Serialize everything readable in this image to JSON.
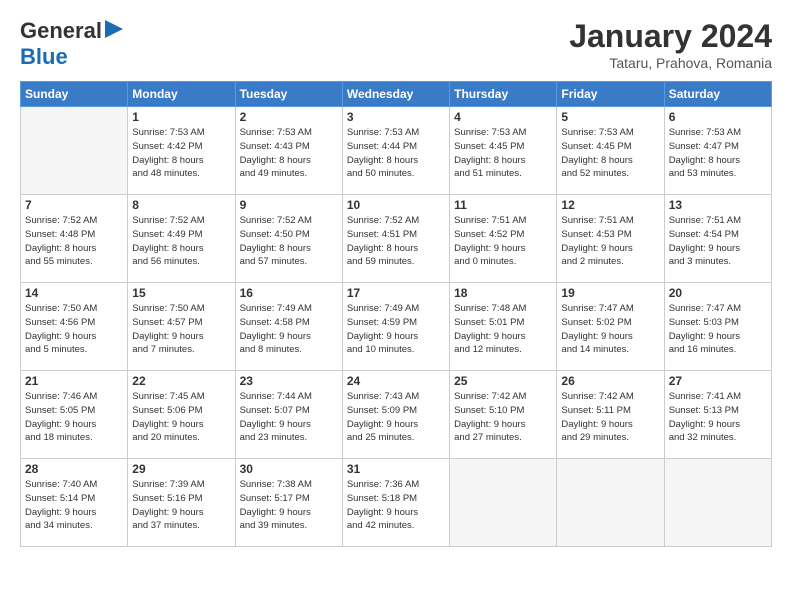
{
  "header": {
    "logo_line1": "General",
    "logo_line2": "Blue",
    "month": "January 2024",
    "location": "Tataru, Prahova, Romania"
  },
  "weekdays": [
    "Sunday",
    "Monday",
    "Tuesday",
    "Wednesday",
    "Thursday",
    "Friday",
    "Saturday"
  ],
  "weeks": [
    [
      {
        "day": "",
        "info": ""
      },
      {
        "day": "1",
        "info": "Sunrise: 7:53 AM\nSunset: 4:42 PM\nDaylight: 8 hours\nand 48 minutes."
      },
      {
        "day": "2",
        "info": "Sunrise: 7:53 AM\nSunset: 4:43 PM\nDaylight: 8 hours\nand 49 minutes."
      },
      {
        "day": "3",
        "info": "Sunrise: 7:53 AM\nSunset: 4:44 PM\nDaylight: 8 hours\nand 50 minutes."
      },
      {
        "day": "4",
        "info": "Sunrise: 7:53 AM\nSunset: 4:45 PM\nDaylight: 8 hours\nand 51 minutes."
      },
      {
        "day": "5",
        "info": "Sunrise: 7:53 AM\nSunset: 4:45 PM\nDaylight: 8 hours\nand 52 minutes."
      },
      {
        "day": "6",
        "info": "Sunrise: 7:53 AM\nSunset: 4:47 PM\nDaylight: 8 hours\nand 53 minutes."
      }
    ],
    [
      {
        "day": "7",
        "info": "Sunrise: 7:52 AM\nSunset: 4:48 PM\nDaylight: 8 hours\nand 55 minutes."
      },
      {
        "day": "8",
        "info": "Sunrise: 7:52 AM\nSunset: 4:49 PM\nDaylight: 8 hours\nand 56 minutes."
      },
      {
        "day": "9",
        "info": "Sunrise: 7:52 AM\nSunset: 4:50 PM\nDaylight: 8 hours\nand 57 minutes."
      },
      {
        "day": "10",
        "info": "Sunrise: 7:52 AM\nSunset: 4:51 PM\nDaylight: 8 hours\nand 59 minutes."
      },
      {
        "day": "11",
        "info": "Sunrise: 7:51 AM\nSunset: 4:52 PM\nDaylight: 9 hours\nand 0 minutes."
      },
      {
        "day": "12",
        "info": "Sunrise: 7:51 AM\nSunset: 4:53 PM\nDaylight: 9 hours\nand 2 minutes."
      },
      {
        "day": "13",
        "info": "Sunrise: 7:51 AM\nSunset: 4:54 PM\nDaylight: 9 hours\nand 3 minutes."
      }
    ],
    [
      {
        "day": "14",
        "info": "Sunrise: 7:50 AM\nSunset: 4:56 PM\nDaylight: 9 hours\nand 5 minutes."
      },
      {
        "day": "15",
        "info": "Sunrise: 7:50 AM\nSunset: 4:57 PM\nDaylight: 9 hours\nand 7 minutes."
      },
      {
        "day": "16",
        "info": "Sunrise: 7:49 AM\nSunset: 4:58 PM\nDaylight: 9 hours\nand 8 minutes."
      },
      {
        "day": "17",
        "info": "Sunrise: 7:49 AM\nSunset: 4:59 PM\nDaylight: 9 hours\nand 10 minutes."
      },
      {
        "day": "18",
        "info": "Sunrise: 7:48 AM\nSunset: 5:01 PM\nDaylight: 9 hours\nand 12 minutes."
      },
      {
        "day": "19",
        "info": "Sunrise: 7:47 AM\nSunset: 5:02 PM\nDaylight: 9 hours\nand 14 minutes."
      },
      {
        "day": "20",
        "info": "Sunrise: 7:47 AM\nSunset: 5:03 PM\nDaylight: 9 hours\nand 16 minutes."
      }
    ],
    [
      {
        "day": "21",
        "info": "Sunrise: 7:46 AM\nSunset: 5:05 PM\nDaylight: 9 hours\nand 18 minutes."
      },
      {
        "day": "22",
        "info": "Sunrise: 7:45 AM\nSunset: 5:06 PM\nDaylight: 9 hours\nand 20 minutes."
      },
      {
        "day": "23",
        "info": "Sunrise: 7:44 AM\nSunset: 5:07 PM\nDaylight: 9 hours\nand 23 minutes."
      },
      {
        "day": "24",
        "info": "Sunrise: 7:43 AM\nSunset: 5:09 PM\nDaylight: 9 hours\nand 25 minutes."
      },
      {
        "day": "25",
        "info": "Sunrise: 7:42 AM\nSunset: 5:10 PM\nDaylight: 9 hours\nand 27 minutes."
      },
      {
        "day": "26",
        "info": "Sunrise: 7:42 AM\nSunset: 5:11 PM\nDaylight: 9 hours\nand 29 minutes."
      },
      {
        "day": "27",
        "info": "Sunrise: 7:41 AM\nSunset: 5:13 PM\nDaylight: 9 hours\nand 32 minutes."
      }
    ],
    [
      {
        "day": "28",
        "info": "Sunrise: 7:40 AM\nSunset: 5:14 PM\nDaylight: 9 hours\nand 34 minutes."
      },
      {
        "day": "29",
        "info": "Sunrise: 7:39 AM\nSunset: 5:16 PM\nDaylight: 9 hours\nand 37 minutes."
      },
      {
        "day": "30",
        "info": "Sunrise: 7:38 AM\nSunset: 5:17 PM\nDaylight: 9 hours\nand 39 minutes."
      },
      {
        "day": "31",
        "info": "Sunrise: 7:36 AM\nSunset: 5:18 PM\nDaylight: 9 hours\nand 42 minutes."
      },
      {
        "day": "",
        "info": ""
      },
      {
        "day": "",
        "info": ""
      },
      {
        "day": "",
        "info": ""
      }
    ]
  ]
}
